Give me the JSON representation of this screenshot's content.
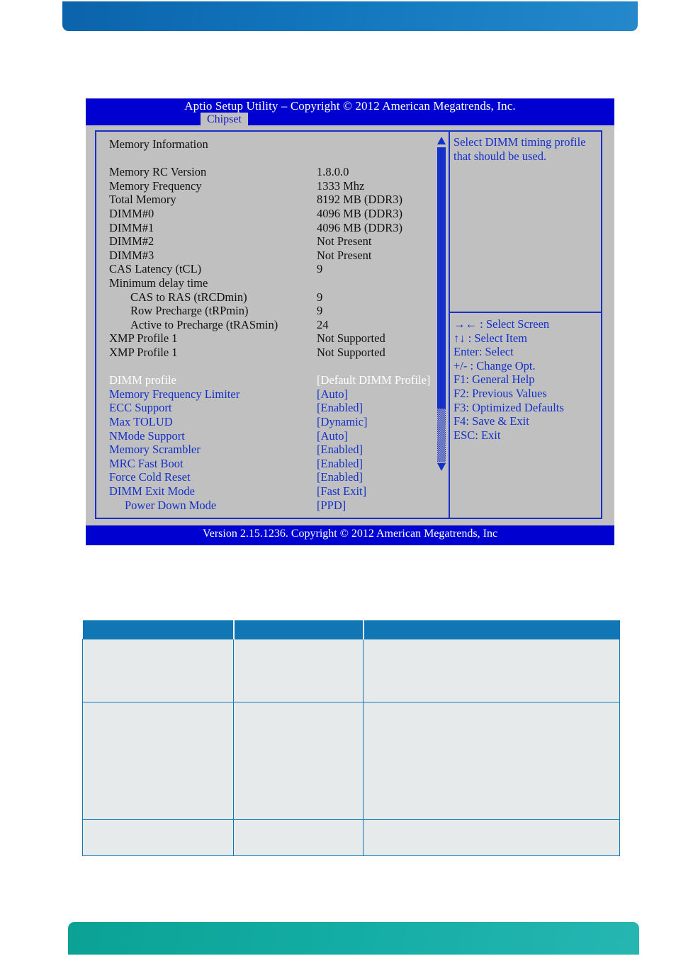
{
  "page": {
    "top_bar_color": "#1276bd",
    "bottom_bar_color": "#14ada5"
  },
  "bios": {
    "title": "Aptio Setup Utility  –  Copyright © 2012 American Megatrends, Inc.",
    "active_tab": "Chipset",
    "footer": "Version 2.15.1236. Copyright © 2012 American Megatrends, Inc",
    "colors": {
      "titlebar": "#0000d0",
      "panel": "#c0c0c0",
      "border": "#1430c8",
      "option_text": "#1430c8",
      "info_text": "#101010",
      "selected_text": "#ffffff"
    },
    "section_heading": "Memory Information",
    "info_rows": [
      {
        "label": "Memory RC Version",
        "value": "1.8.0.0",
        "indent": 0
      },
      {
        "label": "Memory Frequency",
        "value": "1333 Mhz",
        "indent": 0
      },
      {
        "label": "Total Memory",
        "value": "8192 MB (DDR3)",
        "indent": 0
      },
      {
        "label": "DIMM#0",
        "value": "4096 MB (DDR3)",
        "indent": 0
      },
      {
        "label": "DIMM#1",
        "value": "4096 MB (DDR3)",
        "indent": 0
      },
      {
        "label": "DIMM#2",
        "value": "Not Present",
        "indent": 0
      },
      {
        "label": "DIMM#3",
        "value": "Not Present",
        "indent": 0
      },
      {
        "label": "CAS Latency (tCL)",
        "value": "9",
        "indent": 0
      },
      {
        "label": "Minimum delay time",
        "value": "",
        "indent": 0
      },
      {
        "label": "CAS to RAS (tRCDmin)",
        "value": "9",
        "indent": 1
      },
      {
        "label": "Row Precharge (tRPmin)",
        "value": "9",
        "indent": 1
      },
      {
        "label": "Active to Precharge (tRASmin)",
        "value": "24",
        "indent": 1
      },
      {
        "label": "XMP Profile 1",
        "value": "Not Supported",
        "indent": 0
      },
      {
        "label": "XMP Profile 1",
        "value": "Not Supported",
        "indent": 0
      }
    ],
    "option_rows": [
      {
        "label": "DIMM profile",
        "value": "[Default DIMM Profile]",
        "indent": 0,
        "selected": true
      },
      {
        "label": "Memory Frequency Limiter",
        "value": "[Auto]",
        "indent": 0,
        "selected": false
      },
      {
        "label": "ECC Support",
        "value": "[Enabled]",
        "indent": 0,
        "selected": false
      },
      {
        "label": "Max TOLUD",
        "value": "[Dynamic]",
        "indent": 0,
        "selected": false
      },
      {
        "label": "NMode Support",
        "value": "[Auto]",
        "indent": 0,
        "selected": false
      },
      {
        "label": "Memory Scrambler",
        "value": "[Enabled]",
        "indent": 0,
        "selected": false
      },
      {
        "label": "MRC Fast Boot",
        "value": "[Enabled]",
        "indent": 0,
        "selected": false
      },
      {
        "label": "Force Cold Reset",
        "value": "[Enabled]",
        "indent": 0,
        "selected": false
      },
      {
        "label": "DIMM Exit Mode",
        "value": "[Fast Exit]",
        "indent": 0,
        "selected": false
      },
      {
        "label": "Power Down Mode",
        "value": "[PPD]",
        "indent": 2,
        "selected": false
      }
    ],
    "help": {
      "text": "Select DIMM timing profile that should be used."
    },
    "keys": [
      "→←  : Select Screen",
      "↑↓ : Select Item",
      "Enter: Select",
      "+/- : Change Opt.",
      "F1: General Help",
      "F2: Previous Values",
      "F3: Optimized Defaults",
      "F4: Save & Exit",
      "ESC: Exit"
    ],
    "scrollbar": {
      "up_arrow": "scroll-up-arrow",
      "down_arrow": "scroll-down-arrow"
    }
  },
  "table": {
    "headers": [
      "",
      "",
      ""
    ],
    "rows": [
      [
        "",
        "",
        ""
      ],
      [
        "",
        "",
        ""
      ],
      [
        "",
        "",
        ""
      ]
    ]
  }
}
